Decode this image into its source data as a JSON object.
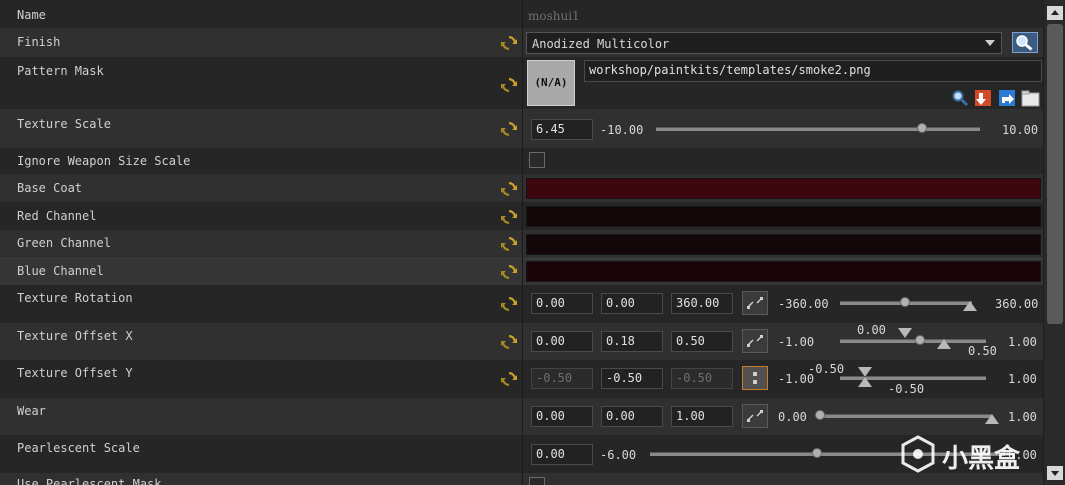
{
  "properties": {
    "name": {
      "label": "Name",
      "value": "moshui1"
    },
    "finish": {
      "label": "Finish",
      "value": "Anodized Multicolor"
    },
    "pattern_mask": {
      "label": "Pattern Mask",
      "thumb": "(N/A)",
      "path": "workshop/paintkits/templates/smoke2.png"
    },
    "texture_scale": {
      "label": "Texture Scale",
      "value": "6.45",
      "min": "-10.00",
      "max": "10.00",
      "level": 0.8225
    },
    "ignore_weapon_size": {
      "label": "Ignore Weapon Size Scale",
      "checked": false
    },
    "base_coat": {
      "label": "Base Coat",
      "color": "#3e0710"
    },
    "red_channel": {
      "label": "Red Channel",
      "color": "#130808"
    },
    "green_channel": {
      "label": "Green Channel",
      "color": "#140709"
    },
    "blue_channel": {
      "label": "Blue Channel",
      "color": "#1a0409"
    },
    "texture_rotation": {
      "label": "Texture Rotation",
      "v1": "0.00",
      "v2": "0.00",
      "v3": "360.00",
      "min": "-360.00",
      "max": "360.00"
    },
    "texture_offset_x": {
      "label": "Texture Offset X",
      "v1": "0.00",
      "v2": "0.18",
      "v3": "0.50",
      "min": "-1.00",
      "max": "1.00",
      "top_label": "0.00",
      "bottom_label": "0.50"
    },
    "texture_offset_y": {
      "label": "Texture Offset Y",
      "v1": "-0.50",
      "v2": "-0.50",
      "v3": "-0.50",
      "min": "-1.00",
      "max": "1.00",
      "top_label": "-0.50",
      "bottom_label": "-0.50"
    },
    "wear": {
      "label": "Wear",
      "v1": "0.00",
      "v2": "0.00",
      "v3": "1.00",
      "min": "0.00",
      "max": "1.00"
    },
    "pearlescent_scale": {
      "label": "Pearlescent Scale",
      "value": "0.00",
      "min": "-6.00",
      "max": "6.00"
    },
    "next_partial": {
      "label": "Use Pearlescent Mask"
    }
  },
  "watermark": {
    "text": "小黑盒"
  },
  "colors": {
    "accent_gold": "#c9a227",
    "lock_active": "#c97b2a"
  }
}
